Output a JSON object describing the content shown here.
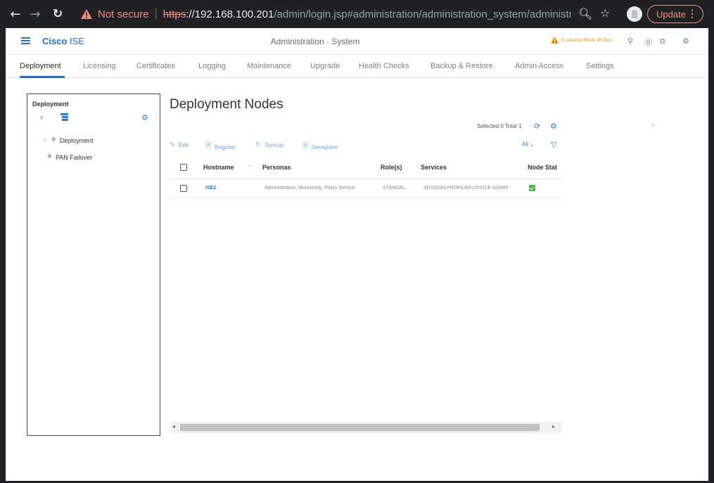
{
  "browser": {
    "security_label": "Not secure",
    "url_scheme": "https",
    "url_host": "://192.168.100.201",
    "url_path": "/admin/login.jsp#administration/administration_system/administration_...",
    "update_label": "Update"
  },
  "header": {
    "brand_bold": "Cisco",
    "brand_light": " ISE",
    "title": "Administration · System",
    "eval_text": "Evaluation Mode 49 Days"
  },
  "tabs": [
    {
      "label": "Deployment",
      "active": true
    },
    {
      "label": "Licensing"
    },
    {
      "label": "Certificates"
    },
    {
      "label": "Logging"
    },
    {
      "label": "Maintenance"
    },
    {
      "label": "Upgrade"
    },
    {
      "label": "Health Checks"
    },
    {
      "label": "Backup & Restore"
    },
    {
      "label": "Admin Access"
    },
    {
      "label": "Settings"
    }
  ],
  "left_panel": {
    "title": "Deployment",
    "items": [
      {
        "label": "Deployment"
      },
      {
        "label": "PAN Failover"
      }
    ]
  },
  "main": {
    "title": "Deployment Nodes",
    "selected_total": "Selected 0  Total 1",
    "toolbar": {
      "edit": "Edit",
      "register": "Register",
      "syncup": "Syncup",
      "deregister": "Deregister",
      "filter_all": "All"
    },
    "columns": [
      "Hostname",
      "Personas",
      "Role(s)",
      "Services",
      "Node Stat"
    ],
    "rows": [
      {
        "hostname": "ISE2",
        "personas": "Administration, Monitoring, Policy Service",
        "roles": "STANDAL...",
        "services": "SESSION,PROFILER,DEVICE ADMIN",
        "status": "ok"
      }
    ]
  }
}
